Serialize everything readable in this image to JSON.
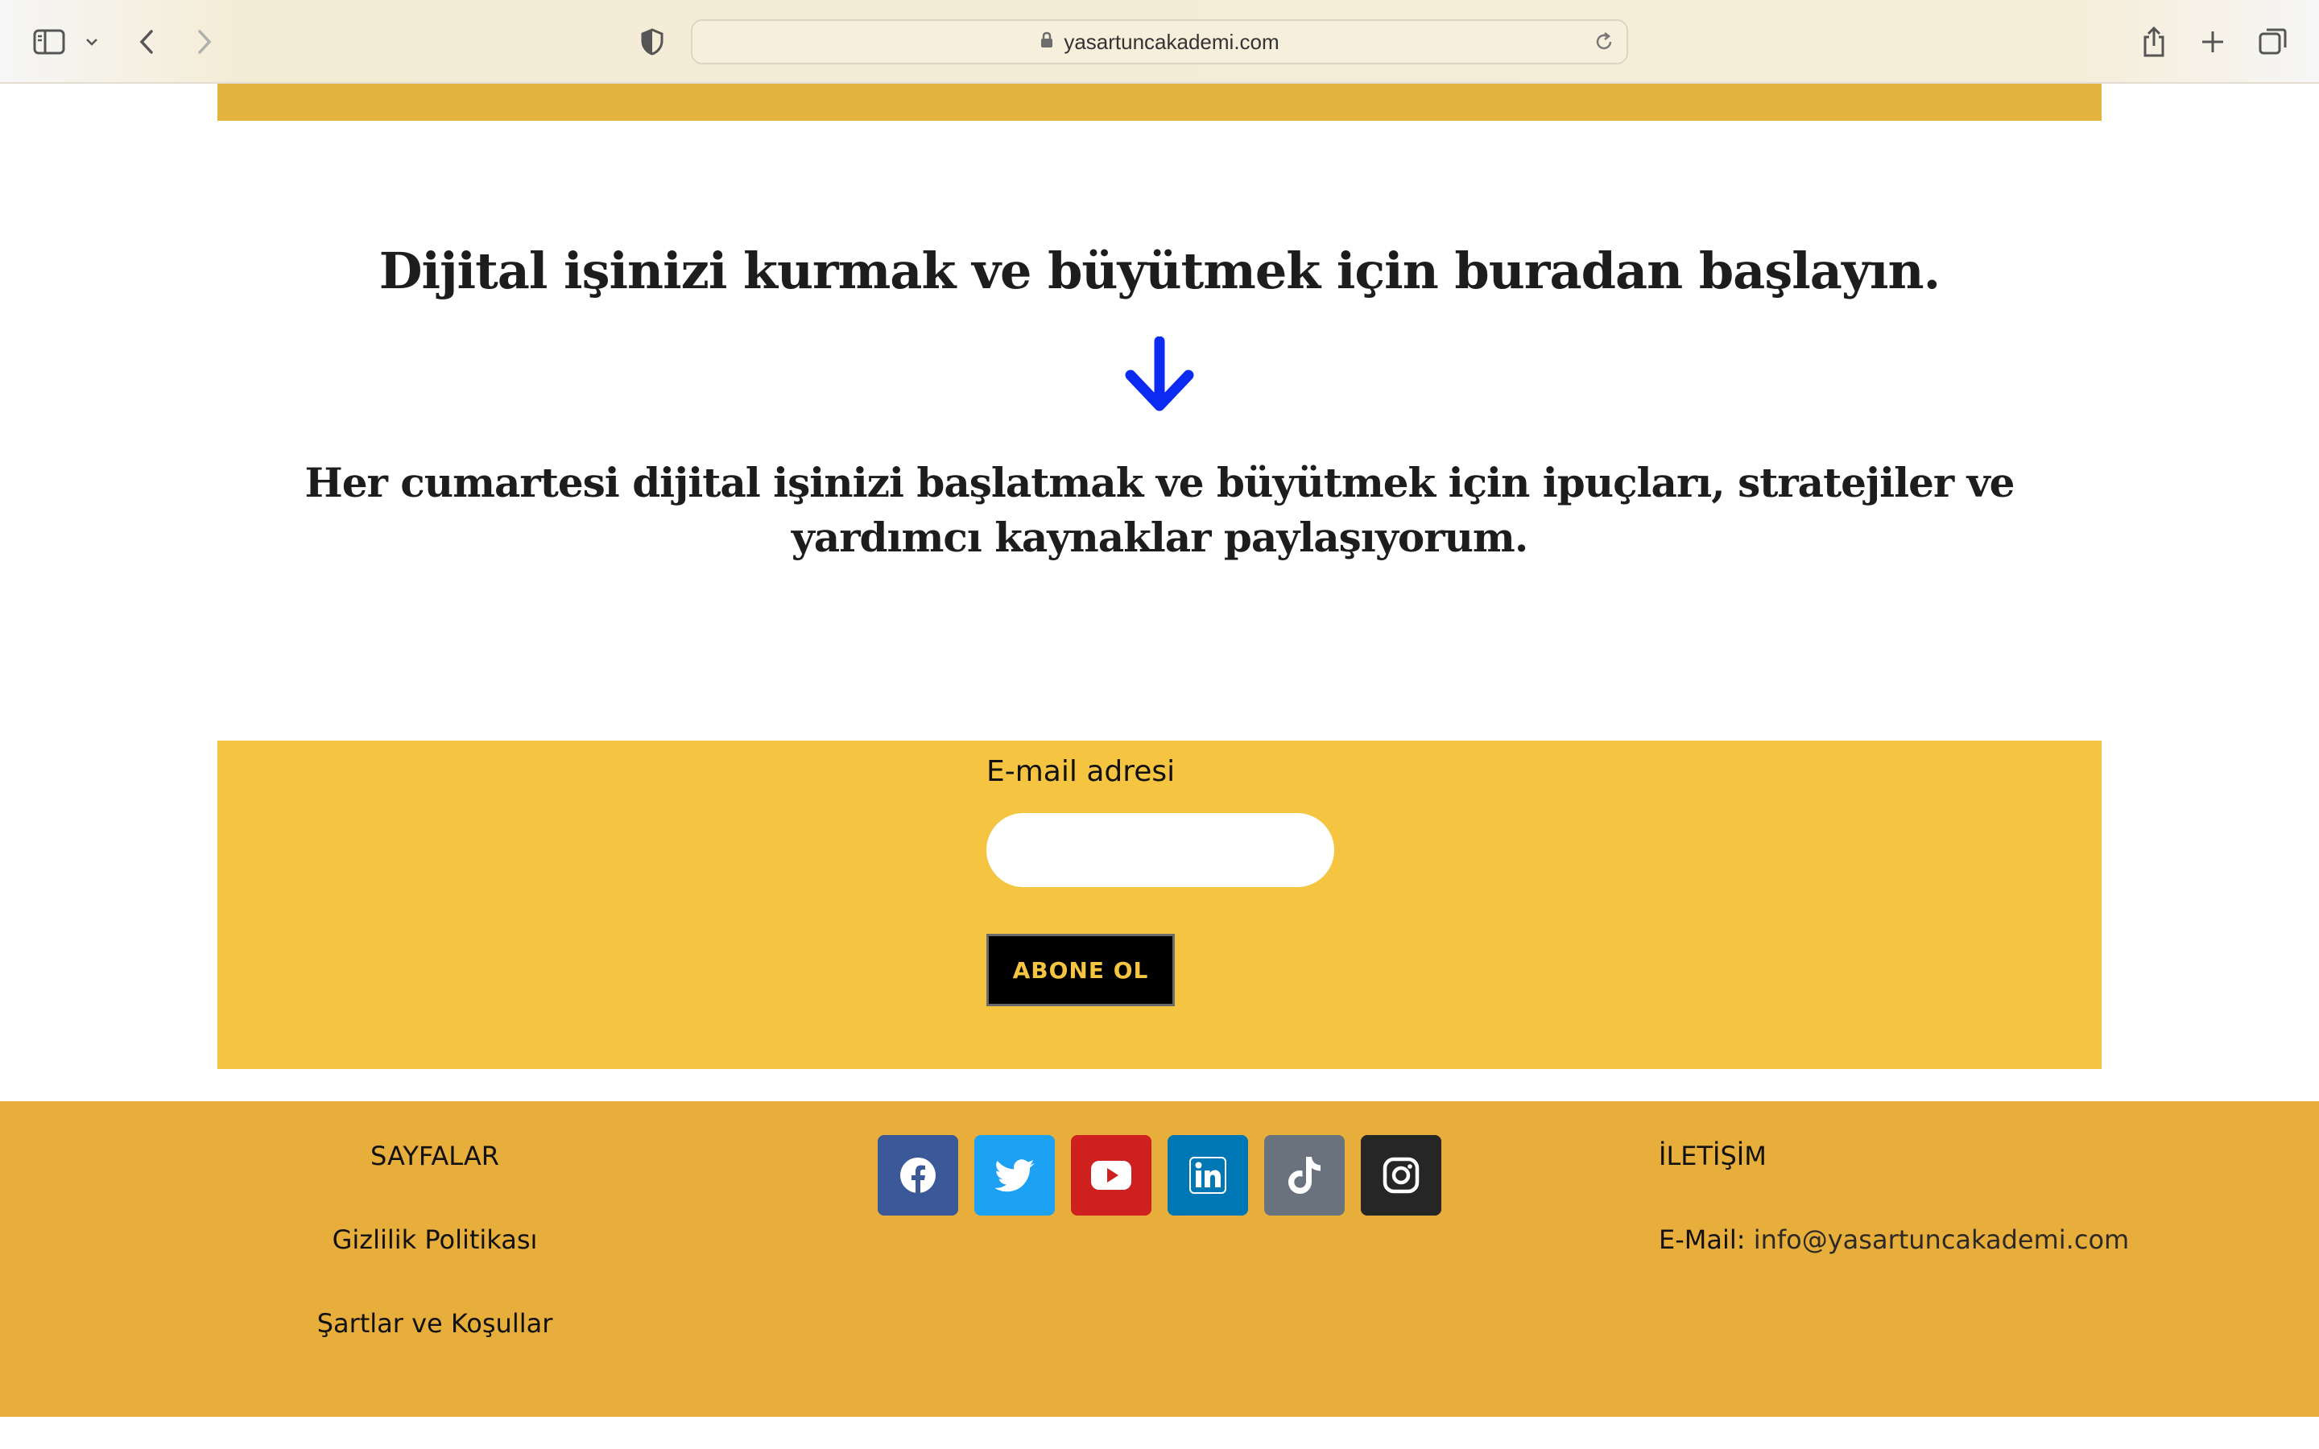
{
  "browser": {
    "url": "yasartuncakademi.com"
  },
  "hero": {
    "headline": "Dijital işinizi kurmak ve büyütmek için buradan başlayın.",
    "subline": "Her cumartesi dijital işinizi başlatmak ve büyütmek için ipuçları, stratejiler ve yardımcı kaynaklar paylaşıyorum.",
    "arrow_color": "#0b2bf2"
  },
  "signup": {
    "email_label": "E-mail adresi",
    "email_value": "",
    "subscribe_label": "ABONE OL",
    "background": "#f5c542"
  },
  "footer": {
    "pages_heading": "SAYFALAR",
    "links": [
      "Gizlilik Politikası",
      "Şartlar ve Koşullar"
    ],
    "social": [
      {
        "name": "facebook-icon",
        "color": "#3b5998"
      },
      {
        "name": "twitter-icon",
        "color": "#1da1f2"
      },
      {
        "name": "youtube-icon",
        "color": "#cd201f"
      },
      {
        "name": "linkedin-icon",
        "color": "#0077b5"
      },
      {
        "name": "tiktok-icon",
        "color": "#69727d"
      },
      {
        "name": "instagram-icon",
        "color": "#262626"
      }
    ],
    "contact_heading": "İLETİŞİM",
    "email_prefix": "E-Mail:",
    "email": "info@yasartuncakademi.com",
    "background": "#e8ae3b"
  }
}
